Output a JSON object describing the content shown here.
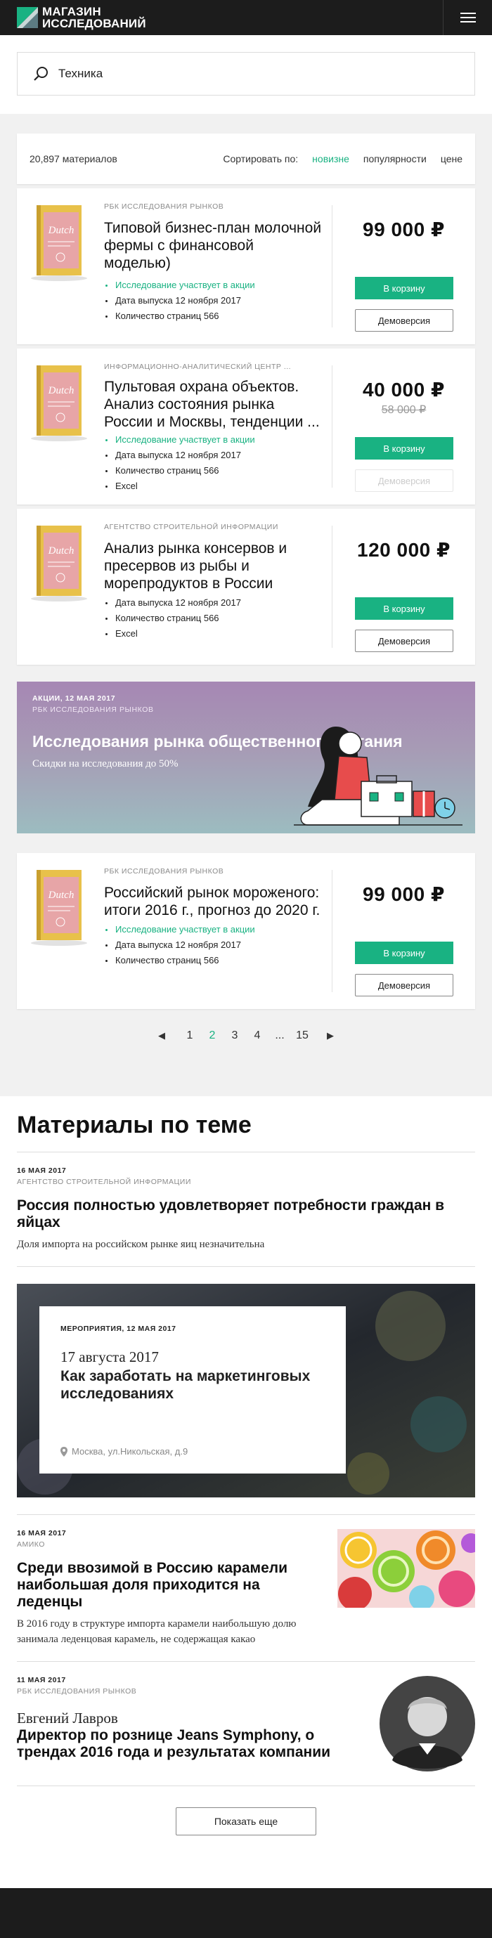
{
  "header": {
    "logo_line1": "МАГАЗИН",
    "logo_line2": "ИССЛЕДОВАНИЙ",
    "menu_icon": "burger-menu-icon"
  },
  "search": {
    "value": "Техника",
    "icon": "search-icon"
  },
  "catalog": {
    "count": "20,897 материалов",
    "sort_label": "Сортировать по:",
    "sort_options": [
      "новизне",
      "популярности",
      "цене"
    ],
    "sort_active": "новизне",
    "items": [
      {
        "source": "РБК ИССЛЕДОВАНИЯ РЫНКОВ",
        "title": "Типовой бизнес-план молочной фермы с финансовой моделью)",
        "features": [
          "Исследование участвует в акции",
          "Дата выпуска 12 ноября 2017",
          "Количество страниц 566"
        ],
        "price": "99 000 ₽",
        "old_price": "",
        "cart": "В корзину",
        "demo": "Демоверсия"
      },
      {
        "source": "ИНФОРМАЦИОННО-АНАЛИТИЧЕСКИЙ ЦЕНТР ...",
        "title": "Пультовая охрана объектов. Анализ состояния рынка России и Москвы, тенденции ...",
        "features": [
          "Исследование участвует в акции",
          "Дата выпуска 12 ноября 2017",
          "Количество страниц 566",
          "Excel"
        ],
        "price": "40 000 ₽",
        "old_price": "58 000 ₽",
        "cart": "В корзину",
        "demo": "Демоверсия"
      },
      {
        "source": "АГЕНТСТВО СТРОИТЕЛЬНОЙ ИНФОРМАЦИИ",
        "title": "Анализ рынка консервов и пресервов из рыбы и морепродуктов в России",
        "features": [
          "Дата выпуска 12 ноября 2017",
          "Количество страниц 566",
          "Excel"
        ],
        "price": "120 000 ₽",
        "old_price": "",
        "cart": "В корзину",
        "demo": "Демоверсия"
      },
      {
        "source": "РБК ИССЛЕДОВАНИЯ РЫНКОВ",
        "title": "Российский рынок мороженого: итоги 2016 г., прогноз до 2020 г.",
        "features": [
          "Исследование участвует в акции",
          "Дата выпуска 12 ноября 2017",
          "Количество страниц 566"
        ],
        "price": "99 000 ₽",
        "old_price": "",
        "cart": "В корзину",
        "demo": "Демоверсия"
      }
    ],
    "book_cover_word": "Dutch",
    "banner": {
      "date": "АКЦИИ, 12 МАЯ 2017",
      "source": "РБК ИССЛЕДОВАНИЯ РЫНКОВ",
      "title": "Исследования рынка общественного питания",
      "subtitle": "Скидки на исследования до 50%"
    },
    "pager": {
      "prev": "◀",
      "pages": [
        "1",
        "2",
        "3",
        "4",
        "...",
        "15"
      ],
      "active": "2",
      "next": "▶"
    }
  },
  "related": {
    "heading": "Материалы по теме",
    "a1": {
      "date": "16 МАЯ 2017",
      "source": "АГЕНТСТВО СТРОИТЕЛЬНОЙ ИНФОРМАЦИИ",
      "title": "Россия полностью удовлетворяет потребности граждан в яйцах",
      "lead": "Доля импорта на российском рынке яиц незначительна"
    },
    "event": {
      "label": "МЕРОПРИЯТИЯ, 12 МАЯ 2017",
      "date": "17 августа 2017",
      "title": "Как заработать на маркетинговых исследованиях",
      "location": "Москва, ул.Никольская, д.9"
    },
    "a2": {
      "date": "16 МАЯ 2017",
      "source": "АМИКО",
      "title": "Среди ввозимой в Россию карамели наибольшая доля приходится на леденцы",
      "lead": "В 2016 году в структуре импорта карамели наибольшую долю занимала леденцовая карамель, не содержащая какао"
    },
    "a3": {
      "date": "11 МАЯ 2017",
      "source": "РБК ИССЛЕДОВАНИЯ РЫНКОВ",
      "person": "Евгений Лавров",
      "title": "Директор по рознице Jeans Symphony, о трендах 2016 года и результатах компании"
    },
    "show_more": "Показать еще"
  },
  "colors": {
    "accent": "#19b282",
    "dark": "#1c1c1c",
    "bg": "#f1f1f1"
  }
}
